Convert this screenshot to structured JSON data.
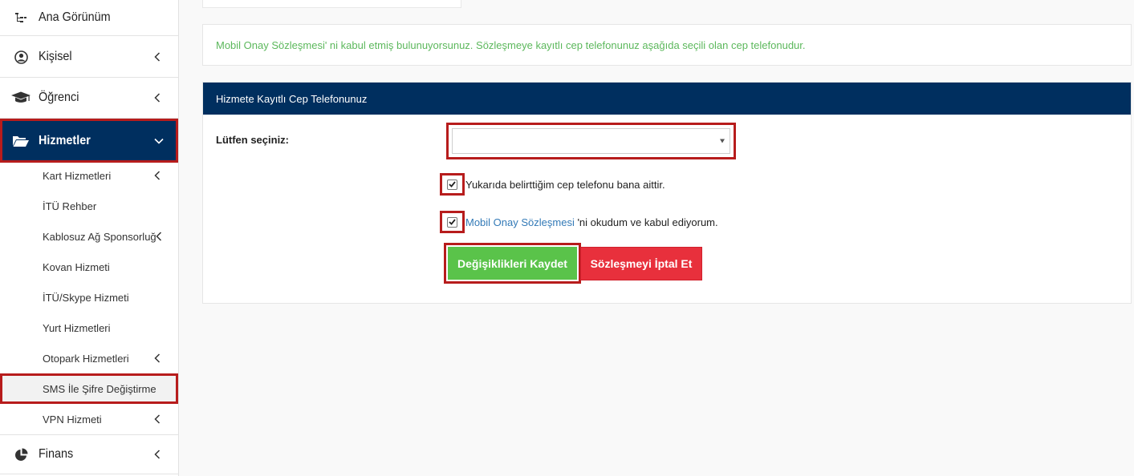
{
  "sidebar": {
    "items": [
      {
        "label": "Ana Görünüm",
        "icon": "sitemap-icon"
      },
      {
        "label": "Kişisel",
        "icon": "user-circle-icon"
      },
      {
        "label": "Öğrenci",
        "icon": "graduation-cap-icon"
      },
      {
        "label": "Hizmetler",
        "icon": "folder-open-icon"
      },
      {
        "label": "Finans",
        "icon": "pie-chart-icon"
      }
    ],
    "subitems": [
      {
        "label": "Kart Hizmetleri"
      },
      {
        "label": "İTÜ Rehber"
      },
      {
        "label": "Kablosuz Ağ Sponsorluğu"
      },
      {
        "label": "Kovan Hizmeti"
      },
      {
        "label": "İTÜ/Skype Hizmeti"
      },
      {
        "label": "Yurt Hizmetleri"
      },
      {
        "label": "Otopark Hizmetleri"
      },
      {
        "label": "SMS İle Şifre Değiştirme"
      },
      {
        "label": "VPN Hizmeti"
      }
    ]
  },
  "main": {
    "info_text": "Mobil Onay Sözleşmesi' ni kabul etmiş bulunuyorsunuz. Sözleşmeye kayıtlı cep telefonunuz aşağıda seçili olan cep telefonudur.",
    "panel_title": "Hizmete Kayıtlı Cep Telefonunuz",
    "select_label": "Lütfen seçiniz:",
    "select_value": "",
    "checkbox1_text": "Yukarıda belirttiğim cep telefonu bana aittir.",
    "checkbox2_link": "Mobil Onay Sözleşmesi",
    "checkbox2_text": " 'ni okudum ve kabul ediyorum.",
    "save_label": "Değişiklikleri Kaydet",
    "cancel_label": "Sözleşmeyi İptal Et"
  },
  "colors": {
    "nav_active": "#002f5f",
    "highlight": "#b71c1c",
    "success_text": "#5cb85c",
    "save_button": "#5ac34a",
    "cancel_button": "#e8303c",
    "link": "#337ab7"
  }
}
